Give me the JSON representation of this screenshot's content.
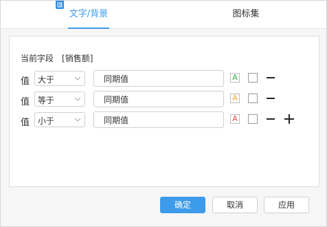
{
  "tabs": [
    {
      "label": "文字/背景",
      "active": true
    },
    {
      "label": "图标集",
      "active": false
    }
  ],
  "field": {
    "label": "当前字段",
    "value": "[销售额]"
  },
  "rules": [
    {
      "label": "值",
      "operator": "大于",
      "value": "同期值",
      "color_letter": "A",
      "color": "#3aa84a",
      "show_minus": true,
      "show_plus": false
    },
    {
      "label": "值",
      "operator": "等于",
      "value": "同期值",
      "color_letter": "A",
      "color": "#f0a020",
      "show_minus": true,
      "show_plus": false
    },
    {
      "label": "值",
      "operator": "小于",
      "value": "同期值",
      "color_letter": "A",
      "color": "#e84848",
      "show_minus": true,
      "show_plus": true
    }
  ],
  "buttons": {
    "ok": "确定",
    "cancel": "取消",
    "apply": "应用"
  },
  "colors": {
    "accent": "#3d9be9"
  }
}
